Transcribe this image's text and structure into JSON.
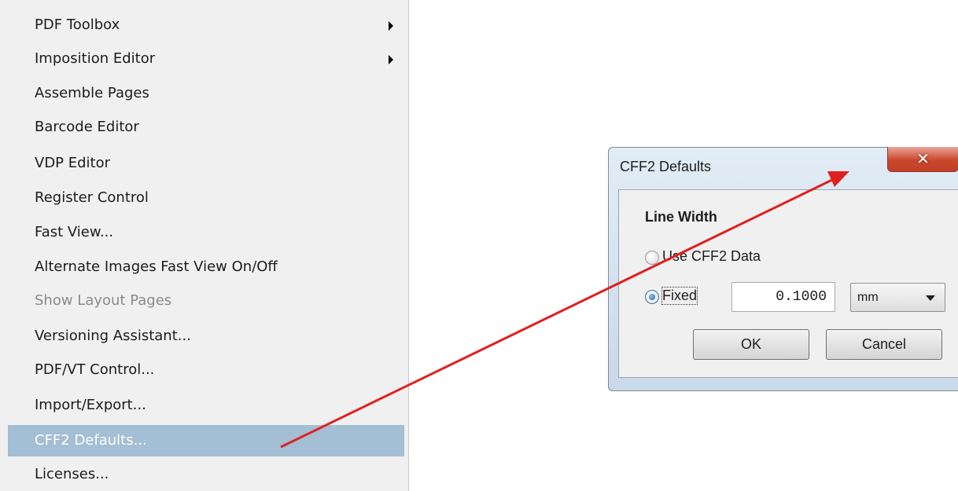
{
  "menu": {
    "items": [
      {
        "label": "PDF Toolbox",
        "submenu": true,
        "state": "normal"
      },
      {
        "label": "Imposition Editor",
        "submenu": true,
        "state": "normal"
      },
      {
        "label": "Assemble Pages",
        "submenu": false,
        "state": "normal"
      },
      {
        "label": "Barcode Editor",
        "submenu": false,
        "state": "normal"
      },
      {
        "label": "VDP Editor",
        "submenu": false,
        "state": "normal"
      },
      {
        "label": "Register Control",
        "submenu": false,
        "state": "normal"
      },
      {
        "label": "Fast View...",
        "submenu": false,
        "state": "normal"
      },
      {
        "label": "Alternate Images Fast View On/Off",
        "submenu": false,
        "state": "normal"
      },
      {
        "label": "Show Layout Pages",
        "submenu": false,
        "state": "disabled"
      },
      {
        "label": "Versioning Assistant...",
        "submenu": false,
        "state": "normal"
      },
      {
        "label": "PDF/VT Control...",
        "submenu": false,
        "state": "normal"
      },
      {
        "label": "Import/Export...",
        "submenu": false,
        "state": "normal"
      },
      {
        "label": "CFF2 Defaults...",
        "submenu": false,
        "state": "selected"
      },
      {
        "label": "Licenses...",
        "submenu": false,
        "state": "normal"
      }
    ],
    "selected_color": "#a4bed4",
    "disabled_color": "#8a8a8a"
  },
  "dialog": {
    "title": "CFF2 Defaults",
    "close_icon": "close-icon",
    "close_glyph": "✕",
    "group_label": "Line Width",
    "options": [
      {
        "label": "Use CFF2 Data",
        "checked": false
      },
      {
        "label": "Fixed",
        "checked": true
      }
    ],
    "width_value": "0.1000",
    "unit_selected": "mm",
    "ok_label": "OK",
    "cancel_label": "Cancel"
  },
  "annotation": {
    "arrow_color": "#e02020",
    "from": "CFF2 Defaults...",
    "to": "CFF2 Defaults"
  }
}
